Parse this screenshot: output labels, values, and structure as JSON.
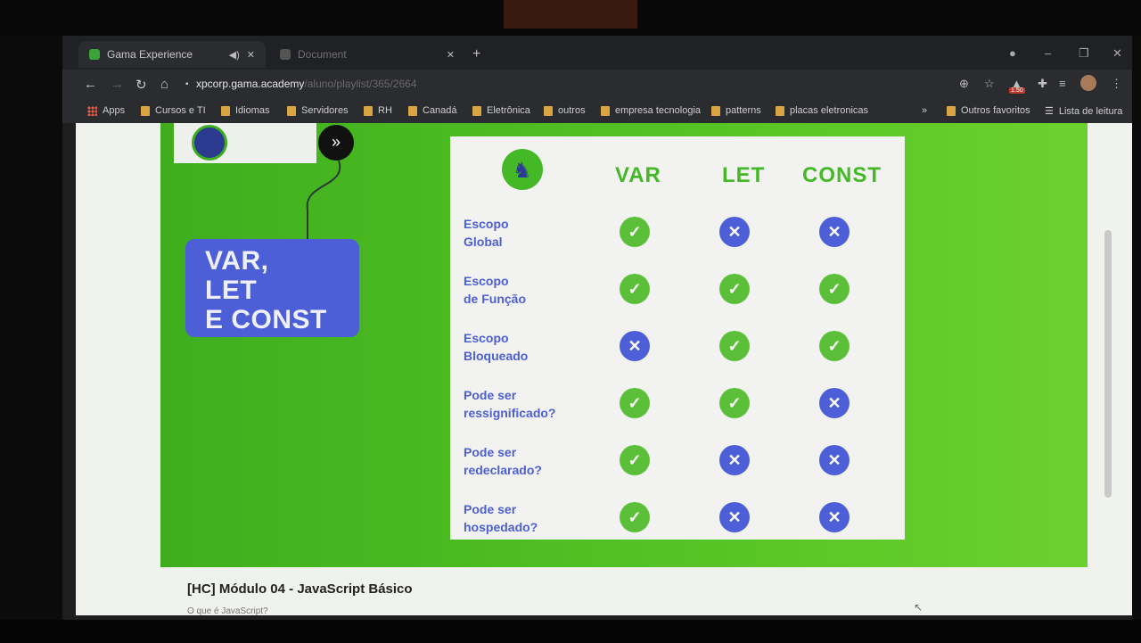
{
  "monitor": {
    "label": ""
  },
  "browser": {
    "tabs": [
      {
        "title": "Gama Experience",
        "active": true
      },
      {
        "title": "Document",
        "active": false
      }
    ],
    "new_tab": "+",
    "window_controls": [
      "–",
      "❐",
      "✕"
    ],
    "url_host": "xpcorp.gama.academy",
    "url_path": "/aluno/playlist/365/2664",
    "extension_badge": "1.50",
    "bookmarks": [
      {
        "label": "Apps",
        "icon": "apps-icon"
      },
      {
        "label": "Cursos e TI",
        "icon": "folder-icon"
      },
      {
        "label": "Idiomas",
        "icon": "folder-icon"
      },
      {
        "label": "Servidores",
        "icon": "folder-icon"
      },
      {
        "label": "RH",
        "icon": "folder-icon"
      },
      {
        "label": "Canadá",
        "icon": "folder-icon"
      },
      {
        "label": "Eletrônica",
        "icon": "folder-icon"
      },
      {
        "label": "outros",
        "icon": "folder-icon"
      },
      {
        "label": "empresa tecnologia",
        "icon": "folder-icon"
      },
      {
        "label": "patterns",
        "icon": "folder-icon"
      },
      {
        "label": "placas eletronicas",
        "icon": "folder-icon"
      }
    ],
    "bookmarks_overflow": "»",
    "other_favorites": "Outros favoritos",
    "reading_list": "Lista de leitura"
  },
  "slide": {
    "title_lines": [
      "VAR,",
      "LET",
      "E CONST"
    ],
    "columns": [
      "VAR",
      "LET",
      "CONST"
    ],
    "rows": [
      {
        "label_lines": [
          "Escopo",
          "Global"
        ],
        "marks": [
          "yes",
          "no",
          "no"
        ]
      },
      {
        "label_lines": [
          "Escopo",
          "de Função"
        ],
        "marks": [
          "yes",
          "yes",
          "yes"
        ]
      },
      {
        "label_lines": [
          "Escopo",
          "Bloqueado"
        ],
        "marks": [
          "no",
          "yes",
          "yes"
        ]
      },
      {
        "label_lines": [
          "Pode ser",
          "ressignificado?"
        ],
        "marks": [
          "yes",
          "yes",
          "no"
        ]
      },
      {
        "label_lines": [
          "Pode ser",
          "redeclarado?"
        ],
        "marks": [
          "yes",
          "no",
          "no"
        ]
      },
      {
        "label_lines": [
          "Pode ser",
          "hospedado?"
        ],
        "marks": [
          "yes",
          "no",
          "no"
        ]
      }
    ],
    "colors": {
      "green": "#45b828",
      "blue": "#4d5fd6",
      "background_green": "#4fbf22"
    }
  },
  "lesson": {
    "module_title": "[HC] Módulo 04 - JavaScript Básico",
    "lesson_subtitle": "O que é JavaScript?"
  }
}
